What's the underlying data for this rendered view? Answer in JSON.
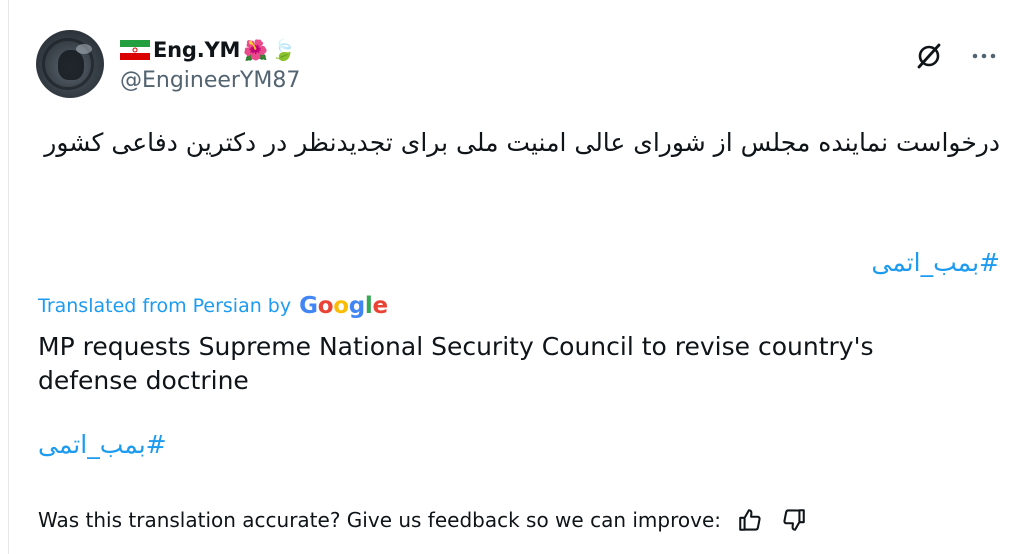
{
  "author": {
    "display_name": "Eng.YM",
    "name_emojis": [
      "🌺",
      "🍃"
    ],
    "handle": "@EngineerYM87",
    "flag_icon": "iran-flag-icon"
  },
  "header_actions": {
    "grok_icon": "grok-icon",
    "more_icon": "more-options-icon"
  },
  "post": {
    "text_fa": "درخواست نماینده مجلس از شورای عالی امنیت ملی برای تجدیدنظر در دکترین دفاعی کشور",
    "hashtag": "#بمب_اتمی"
  },
  "translation": {
    "label": "Translated from Persian by",
    "provider": [
      "G",
      "o",
      "o",
      "g",
      "l",
      "e"
    ],
    "text_en": "MP requests Supreme National Security Council to revise country's defense doctrine",
    "hashtag": "#بمب_اتمی"
  },
  "feedback": {
    "question": "Was this translation accurate? Give us feedback so we can improve:",
    "thumbs_up_icon": "thumbs-up-icon",
    "thumbs_down_icon": "thumbs-down-icon"
  },
  "colors": {
    "link": "#1d9bf0",
    "secondary_text": "#536471",
    "primary_text": "#0f1419"
  }
}
